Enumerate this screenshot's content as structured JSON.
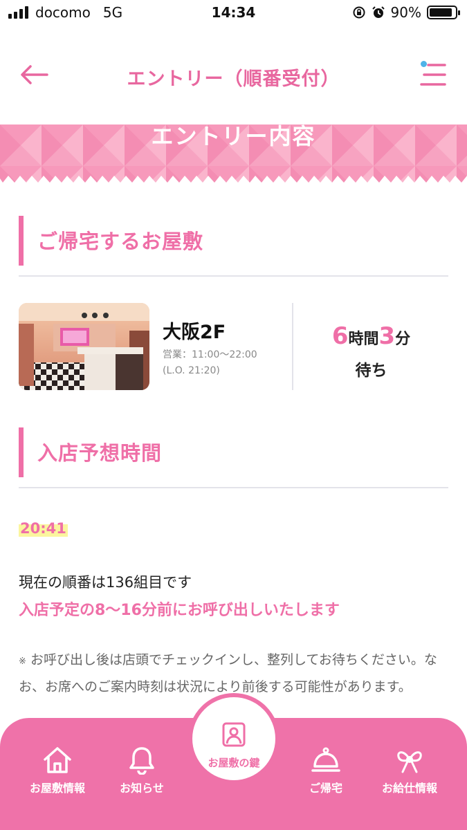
{
  "status_bar": {
    "carrier": "docomo",
    "network": "5G",
    "time": "14:34",
    "battery_percent": "90%",
    "battery_level": 0.9
  },
  "header": {
    "title": "エントリー（順番受付）",
    "back_icon": "arrow-left-icon",
    "menu_icon": "menu-icon",
    "notification_dot_color": "#4eb3e8"
  },
  "banner": {
    "title": "エントリー内容"
  },
  "shop_section": {
    "heading": "ご帰宅するお屋敷",
    "name": "大阪2F",
    "hours": "営業：11:00〜22:00",
    "last_order": "(L.O. 21:20)",
    "wait": {
      "hours_value": "6",
      "hours_unit": "時間",
      "minutes_value": "3",
      "minutes_unit": "分",
      "suffix": "待ち"
    }
  },
  "entry_section": {
    "heading": "入店予想時間",
    "time": "20:41",
    "queue_text": "現在の順番は136組目です",
    "call_text": "入店予定の8〜16分前にお呼び出しいたします",
    "note_mark": "※",
    "note_text": "お呼び出し後は店頭でチェックインし、整列してお待ちください。なお、お席へのご案内時刻は状況により前後する可能性があります。"
  },
  "bottom_nav": {
    "items": [
      {
        "label": "お屋敷情報",
        "icon": "house-icon"
      },
      {
        "label": "お知らせ",
        "icon": "bell-icon"
      },
      {
        "label": "お屋敷の鍵",
        "icon": "key-card-icon"
      },
      {
        "label": "ご帰宅",
        "icon": "service-bell-icon"
      },
      {
        "label": "お給仕情報",
        "icon": "ribbon-icon"
      }
    ]
  },
  "colors": {
    "accent_pink": "#ef6fa7",
    "nav_pink": "#ef72a9",
    "highlight_yellow": "#fbf59e",
    "divider": "#e3e3ea"
  }
}
